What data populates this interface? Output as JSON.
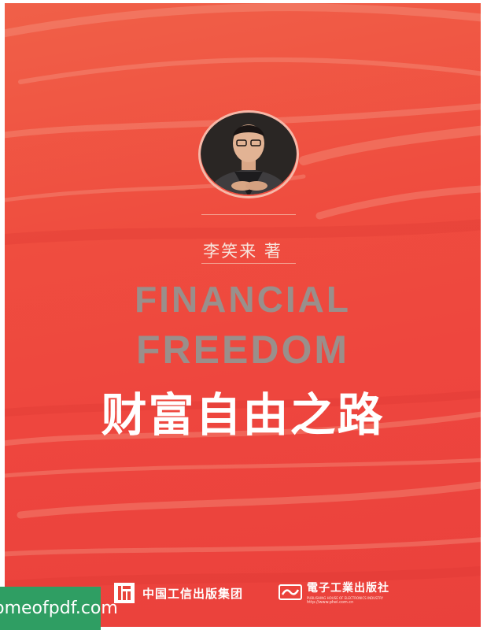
{
  "cover": {
    "author": "李笑来 著",
    "title_en_line1": "FINANCIAL",
    "title_en_line2": "FREEDOM",
    "title_cn": "财富自由之路"
  },
  "portrait": {
    "icon": "author-photo"
  },
  "publishers": {
    "group_name": "中国工信出版集团",
    "house_name_cn": "電子工業出版社",
    "house_name_en": "PUBLISHING HOUSE OF ELECTRONICS INDUSTRY",
    "house_url": "http://www.phei.com.cn"
  },
  "watermark": {
    "text": "homeofpdf.com"
  },
  "colors": {
    "background": "#ee463e",
    "title_en": "#9a8f8b",
    "title_cn": "#ffffff",
    "watermark": "#2f9e63"
  }
}
